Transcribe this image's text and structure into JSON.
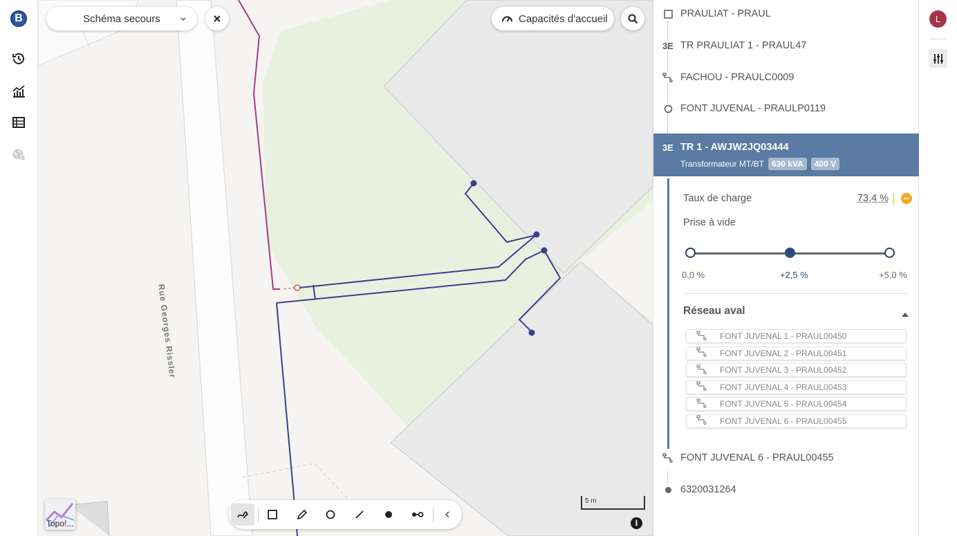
{
  "nav": {
    "logo_letter": "B",
    "items": [
      "history-icon",
      "chart-icon",
      "table-icon",
      "globe-icon"
    ]
  },
  "map": {
    "scheme_select": "Schéma secours",
    "capacity_button": "Capacités d'accueil",
    "street_name": "Rue Georges Rissler",
    "scale_label": "5 m",
    "topo_label": "Topo!...",
    "info": "i"
  },
  "tree": {
    "items": [
      {
        "icon": "square-icon",
        "label": "PRAULIAT - PRAUL"
      },
      {
        "icon": "transformer-icon",
        "label": "TR PRAULIAT 1 - PRAUL47"
      },
      {
        "icon": "feeder-icon",
        "label": "FACHOU - PRAULC0009"
      },
      {
        "icon": "circle-icon",
        "label": "FONT JUVENAL - PRAULP0119"
      }
    ],
    "selected": {
      "title": "TR 1 - AWJW2JQ03444",
      "subtitle": "Transformateur MT/BT",
      "power": "630 kVA",
      "voltage": "400 V"
    },
    "after": [
      {
        "icon": "feeder-icon",
        "label": "FONT JUVENAL 6 - PRAUL00455"
      },
      {
        "icon": "dot-icon",
        "label": "6320031264"
      }
    ]
  },
  "details": {
    "load_label": "Taux de charge",
    "load_value": "73,4 %",
    "tap_label": "Prise à vide",
    "tap_options": [
      "0,0 %",
      "+2,5 %",
      "+5,0 %"
    ],
    "tap_selected_index": 1,
    "downstream_title": "Réseau aval",
    "downstream": [
      "FONT JUVENAL 1 - PRAUL00450",
      "FONT JUVENAL 2 - PRAUL00451",
      "FONT JUVENAL 3 - PRAUL00452",
      "FONT JUVENAL 4 - PRAUL00453",
      "FONT JUVENAL 5 - PRAUL00454",
      "FONT JUVENAL 6 - PRAUL00455"
    ]
  },
  "user": {
    "initial": "L"
  },
  "colors": {
    "selected_bg": "#5a7ba3",
    "network_line": "#3b3f8f",
    "hta_line": "#a23f7e",
    "warning": "#f5a623"
  }
}
